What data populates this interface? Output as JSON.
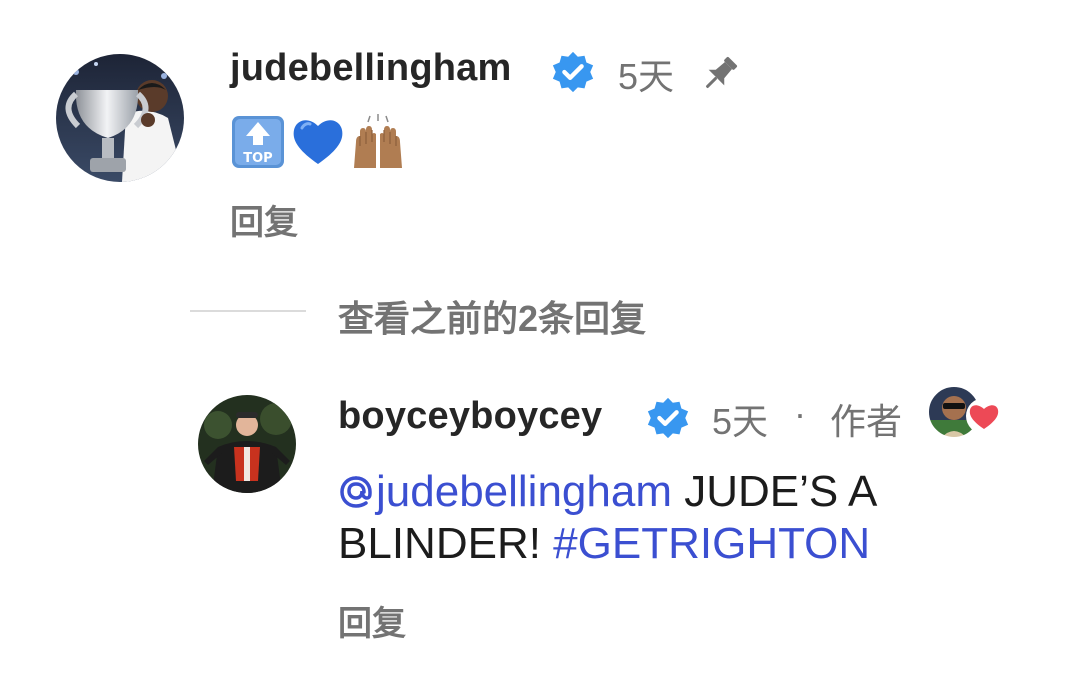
{
  "colors": {
    "text_primary": "#262626",
    "text_secondary": "#737373",
    "link": "#3b4fd1",
    "verified": "#3897f0",
    "divider": "#dbdbdb",
    "heart": "#ed4956"
  },
  "comments": [
    {
      "username": "judebellingham",
      "verified": true,
      "time": "5天",
      "pinned": true,
      "icons": [
        "verified-badge-icon",
        "pin-icon"
      ],
      "emojis": [
        "top-arrow-emoji",
        "blue-heart-emoji",
        "raising-hands-emoji"
      ],
      "reply_label": "回复"
    }
  ],
  "view_previous": "查看之前的2条回复",
  "reply": {
    "username": "boyceyboycey",
    "verified": true,
    "time": "5天",
    "separator": "·",
    "author_label": "作者",
    "author_liked": true,
    "mention": "judebellingham",
    "text_after_mention": " JUDE’S A BLINDER! ",
    "hashtag": "#GETRIGHTON",
    "reply_label": "回复"
  }
}
